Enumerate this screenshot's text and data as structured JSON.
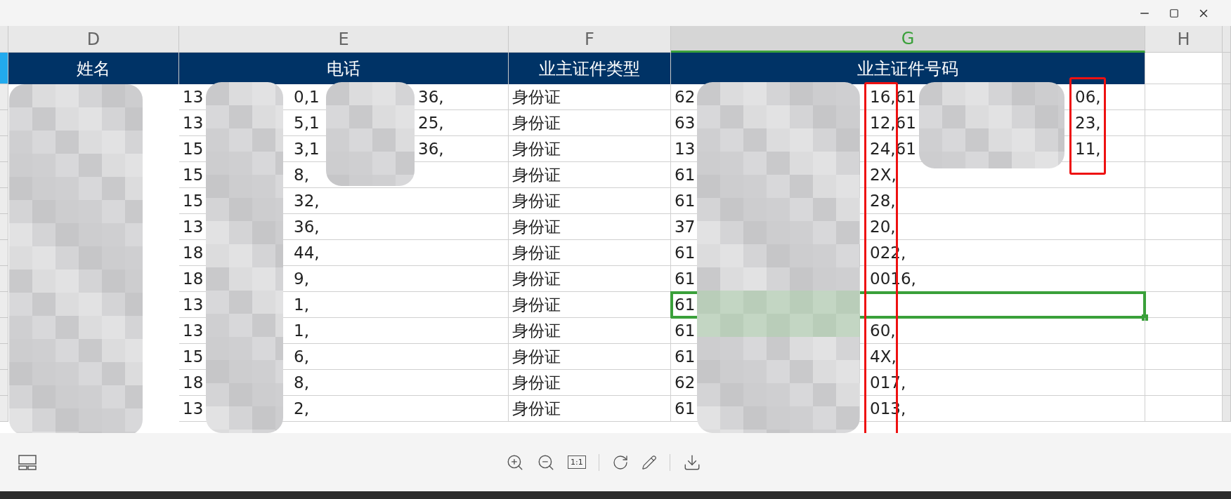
{
  "sheet": {
    "columns": [
      {
        "letter": "D",
        "selected": false
      },
      {
        "letter": "E",
        "selected": false
      },
      {
        "letter": "F",
        "selected": false
      },
      {
        "letter": "G",
        "selected": true
      },
      {
        "letter": "H",
        "selected": false
      }
    ],
    "header_row": [
      "姓名",
      "电话",
      "业主证件类型",
      "业主证件号码"
    ],
    "rows": [
      {
        "selected": false,
        "phone": [
          "13",
          "0,1",
          "36,"
        ],
        "id_type": "身份证",
        "id_number": [
          "62",
          "16,61",
          "06,"
        ]
      },
      {
        "selected": false,
        "phone": [
          "13",
          "5,1",
          "25,"
        ],
        "id_type": "身份证",
        "id_number": [
          "63",
          "12,61",
          "23,"
        ]
      },
      {
        "selected": false,
        "phone": [
          "15",
          "3,1",
          "36,"
        ],
        "id_type": "身份证",
        "id_number": [
          "13",
          "24,61",
          "11,"
        ]
      },
      {
        "selected": false,
        "phone": [
          "15",
          "8,"
        ],
        "id_type": "身份证",
        "id_number": [
          "61",
          "2X,"
        ]
      },
      {
        "selected": false,
        "phone": [
          "15",
          "32,"
        ],
        "id_type": "身份证",
        "id_number": [
          "61",
          "28,"
        ]
      },
      {
        "selected": false,
        "phone": [
          "13",
          "36,"
        ],
        "id_type": "身份证",
        "id_number": [
          "37",
          "20,"
        ]
      },
      {
        "selected": false,
        "phone": [
          "18",
          "44,"
        ],
        "id_type": "身份证",
        "id_number": [
          "61",
          "022,"
        ]
      },
      {
        "selected": false,
        "phone": [
          "18",
          "9,"
        ],
        "id_type": "身份证",
        "id_number": [
          "61",
          "0016,"
        ]
      },
      {
        "selected": true,
        "phone": [
          "13",
          "1,"
        ],
        "id_type": "身份证",
        "id_number": [
          "61"
        ]
      },
      {
        "selected": false,
        "phone": [
          "13",
          "1,"
        ],
        "id_type": "身份证",
        "id_number": [
          "61",
          "60,"
        ]
      },
      {
        "selected": false,
        "phone": [
          "15",
          "6,"
        ],
        "id_type": "身份证",
        "id_number": [
          "61",
          "4X,"
        ]
      },
      {
        "selected": false,
        "phone": [
          "18",
          "8,"
        ],
        "id_type": "身份证",
        "id_number": [
          "62",
          "017,"
        ]
      },
      {
        "selected": false,
        "phone": [
          "13",
          "2,"
        ],
        "id_type": "身份证",
        "id_number": [
          "61",
          "013,"
        ]
      }
    ]
  },
  "toolbar": {
    "actual_size_label": "1:1"
  }
}
